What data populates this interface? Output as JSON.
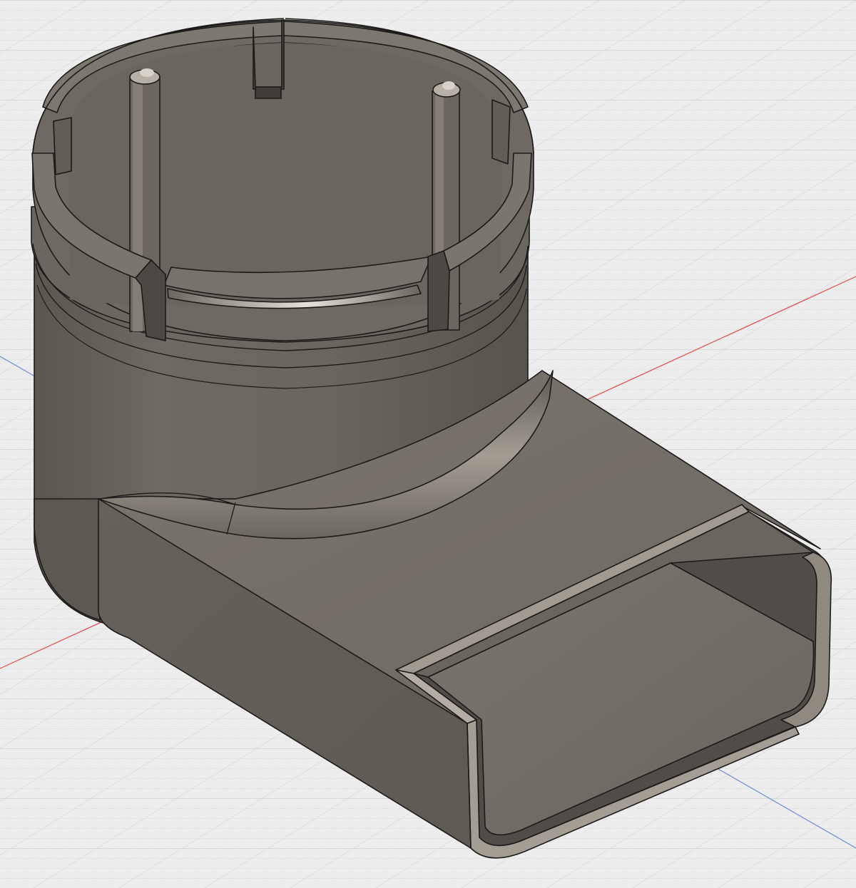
{
  "viewport": {
    "name": "3d-model-viewport",
    "background_color": "#ededed",
    "grid_minor_color": "#dadada",
    "grid_major_color": "#c6c6c6",
    "axis_x_color": "#e5484d",
    "axis_y_color": "#6d8bd9"
  },
  "model": {
    "name": "duct-adapter-body",
    "body_color": "#6f6a63",
    "body_dark_color": "#4f4b46",
    "body_light_color": "#9b958c",
    "edge_color": "#1c1b19",
    "features": [
      "circular-collar",
      "retention-tabs",
      "guide-pins",
      "top-slot",
      "rectangular-outlet"
    ]
  }
}
